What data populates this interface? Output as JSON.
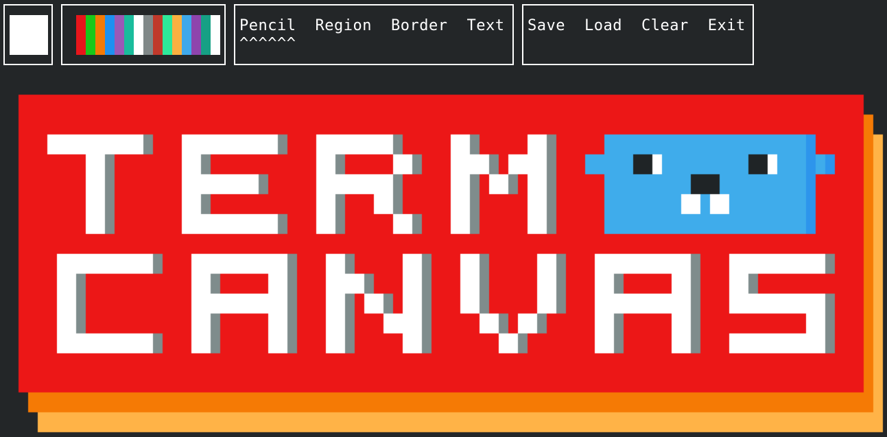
{
  "app": {
    "name": "Term Canvas"
  },
  "toolbar": {
    "current_color": "#ffffff",
    "palette": [
      "#e8151b",
      "#19c819",
      "#f47a06",
      "#1e90f0",
      "#9b59b6",
      "#1abc9c",
      "#ffffff",
      "#808888",
      "#c0392b",
      "#2ee89a",
      "#fbb040",
      "#3ea8ea",
      "#8e44ad",
      "#16a085",
      "#ffffff"
    ],
    "tools": [
      {
        "id": "pencil",
        "label": "Pencil"
      },
      {
        "id": "region",
        "label": "Region"
      },
      {
        "id": "border",
        "label": "Border"
      },
      {
        "id": "text",
        "label": "Text"
      }
    ],
    "selected_tool_marker": "^^^^^^",
    "actions": [
      {
        "id": "save",
        "label": "Save"
      },
      {
        "id": "load",
        "label": "Load"
      },
      {
        "id": "clear",
        "label": "Clear"
      },
      {
        "id": "exit",
        "label": "Exit"
      }
    ]
  },
  "canvas": {
    "artwork_text": [
      "TERM",
      "CANVAS"
    ],
    "colors": {
      "background": "#232628",
      "panel_red": "#ec1717",
      "shadow_orange": "#f57a05",
      "shadow_yellow": "#ffb347",
      "letter_white": "#ffffff",
      "letter_shadow": "#7f8c8c",
      "creature_blue": "#3faceb",
      "creature_dark_blue": "#2d95ec",
      "creature_eye": "#1f2426"
    }
  }
}
